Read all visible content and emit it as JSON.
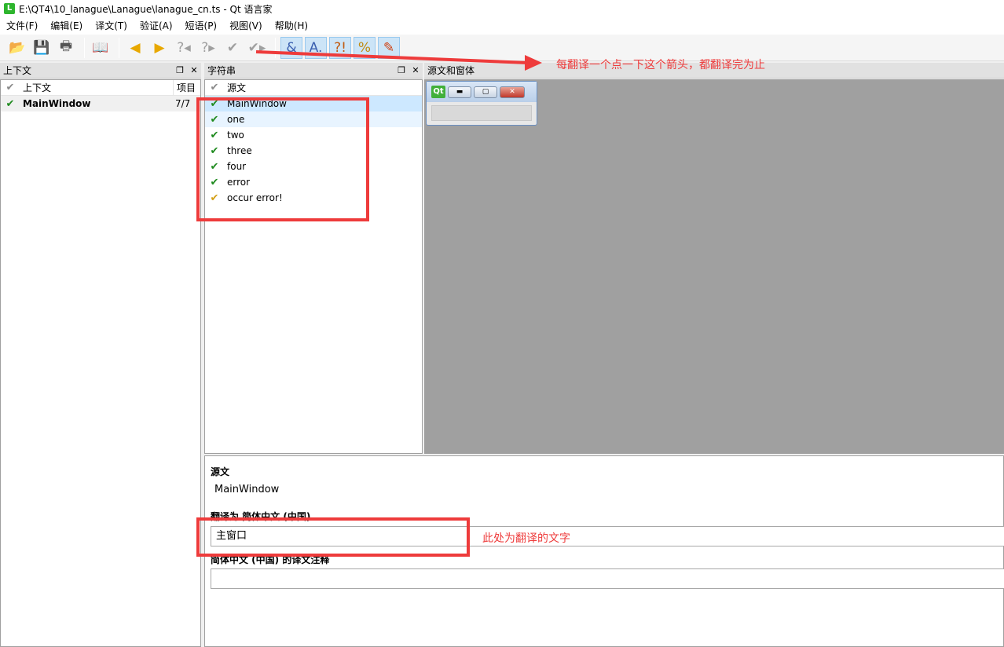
{
  "window": {
    "title": "E:\\QT4\\10_lanague\\Lanague\\lanague_cn.ts - Qt 语言家",
    "app_icon": "L"
  },
  "menu": [
    "文件(F)",
    "编辑(E)",
    "译文(T)",
    "验证(A)",
    "短语(P)",
    "视图(V)",
    "帮助(H)"
  ],
  "toolbar": {
    "icons": [
      "open-icon",
      "save-icon",
      "print-icon",
      "phrasebook-icon",
      "prev-icon",
      "next-icon",
      "prev-unfinished-icon",
      "next-unfinished-icon",
      "done-icon",
      "done-next-icon",
      "accelerator-check-icon",
      "punctuation-check-icon",
      "phrase-check-icon",
      "placemarker-check-icon",
      "validation-icon"
    ]
  },
  "context_panel": {
    "title": "上下文",
    "headers": [
      "上下文",
      "项目"
    ],
    "rows": [
      {
        "name": "MainWindow",
        "items": "7/7"
      }
    ]
  },
  "strings_panel": {
    "title": "字符串",
    "header": "源文",
    "rows": [
      {
        "text": "MainWindow",
        "status": "done"
      },
      {
        "text": "one",
        "status": "done"
      },
      {
        "text": "two",
        "status": "done"
      },
      {
        "text": "three",
        "status": "done"
      },
      {
        "text": "four",
        "status": "done"
      },
      {
        "text": "error",
        "status": "done"
      },
      {
        "text": "occur error!",
        "status": "warning"
      }
    ]
  },
  "source_panel": {
    "title": "源文和窗体",
    "mini_logo": "Qt"
  },
  "editor": {
    "source_label": "源文",
    "source_text": "MainWindow",
    "translate_label": "翻译为 简体中文 (中国)",
    "translation": "主窗口",
    "comment_label": "简体中文 (中国) 的译文注释",
    "comment": ""
  },
  "annotations": {
    "arrow_note": "每翻译一个点一下这个箭头，都翻译完为止",
    "field_note": "此处为翻译的文字",
    "color": "#ee3b3b"
  }
}
